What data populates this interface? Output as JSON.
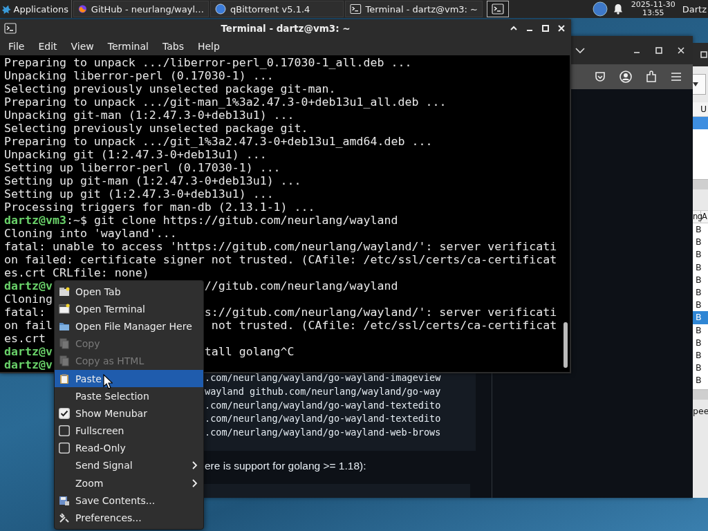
{
  "taskbar": {
    "apps_menu": "Applications",
    "tasks": [
      {
        "title": "GitHub - neurlang/wayl…",
        "kind": "browser"
      },
      {
        "title": "qBittorrent v5.1.4",
        "kind": "torrent"
      },
      {
        "title": "Terminal - dartz@vm3: ~",
        "kind": "terminal"
      }
    ],
    "clock": {
      "date": "2025-11-30",
      "time": "13:55"
    },
    "user": "Dartz"
  },
  "browser": {
    "code_lines": [
      ".com/neurlang/wayland/go-wayland-imageview",
      "wayland github.com/neurlang/wayland/go-way",
      ".com/neurlang/wayland/go-wayland-textedito",
      ".com/neurlang/wayland/go-wayland-textedito",
      ".com/neurlang/wayland/go-wayland-web-brows"
    ],
    "paragraph": "ere is support for golang >= 1.18):"
  },
  "qbittorrent": {
    "list": {
      "header": "U",
      "rows": [
        {
          "selected": true
        }
      ]
    },
    "peers": {
      "headers": [
        "ng",
        "A"
      ],
      "rows": [
        {
          "text": "B",
          "selected": false
        },
        {
          "text": "B",
          "selected": false
        },
        {
          "text": "B",
          "selected": false
        },
        {
          "text": "B",
          "selected": false
        },
        {
          "text": "B",
          "selected": false
        },
        {
          "text": "B",
          "selected": false
        },
        {
          "text": "B",
          "selected": false
        },
        {
          "text": "B",
          "selected": true
        },
        {
          "text": "B",
          "selected": false
        },
        {
          "text": "B",
          "selected": false
        },
        {
          "text": "B",
          "selected": false
        },
        {
          "text": "B",
          "selected": false
        },
        {
          "text": "B",
          "selected": false
        }
      ]
    },
    "status": "pee"
  },
  "terminal": {
    "title": "Terminal - dartz@vm3: ~",
    "menu": [
      "File",
      "Edit",
      "View",
      "Terminal",
      "Tabs",
      "Help"
    ],
    "lines": [
      {
        "kind": "output",
        "text": "Preparing to unpack .../liberror-perl_0.17030-1_all.deb ..."
      },
      {
        "kind": "output",
        "text": "Unpacking liberror-perl (0.17030-1) ..."
      },
      {
        "kind": "output",
        "text": "Selecting previously unselected package git-man."
      },
      {
        "kind": "output",
        "text": "Preparing to unpack .../git-man_1%3a2.47.3-0+deb13u1_all.deb ..."
      },
      {
        "kind": "output",
        "text": "Unpacking git-man (1:2.47.3-0+deb13u1) ..."
      },
      {
        "kind": "output",
        "text": "Selecting previously unselected package git."
      },
      {
        "kind": "output",
        "text": "Preparing to unpack .../git_1%3a2.47.3-0+deb13u1_amd64.deb ..."
      },
      {
        "kind": "output",
        "text": "Unpacking git (1:2.47.3-0+deb13u1) ..."
      },
      {
        "kind": "output",
        "text": "Setting up liberror-perl (0.17030-1) ..."
      },
      {
        "kind": "output",
        "text": "Setting up git-man (1:2.47.3-0+deb13u1) ..."
      },
      {
        "kind": "output",
        "text": "Setting up git (1:2.47.3-0+deb13u1) ..."
      },
      {
        "kind": "output",
        "text": "Processing triggers for man-db (2.13.1-1) ..."
      },
      {
        "kind": "prompt",
        "user": "dartz@vm3",
        "path": ":~$",
        "command": "git clone https://gitub.com/neurlang/wayland"
      },
      {
        "kind": "output",
        "text": "Cloning into 'wayland'..."
      },
      {
        "kind": "output",
        "text": "fatal: unable to access 'https://gitub.com/neurlang/wayland/': server verificati"
      },
      {
        "kind": "output",
        "text": "on failed: certificate signer not trusted. (CAfile: /etc/ssl/certs/ca-certificat"
      },
      {
        "kind": "output",
        "text": "es.crt CRLfile: none)"
      },
      {
        "kind": "covered_prompt",
        "left": "dartz@v",
        "right": "//gitub.com/neurlang/wayland"
      },
      {
        "kind": "covered",
        "left": "Cloning"
      },
      {
        "kind": "covered",
        "left": "fatal:",
        "right": "s://gitub.com/neurlang/wayland/': server verificati"
      },
      {
        "kind": "covered",
        "left": "on fail",
        "right": " not trusted. (CAfile: /etc/ssl/certs/ca-certificat"
      },
      {
        "kind": "covered",
        "left": "es.crt"
      },
      {
        "kind": "covered_prompt",
        "left": "dartz@v",
        "right": "tall golang^C"
      },
      {
        "kind": "covered_prompt",
        "left": "dartz@v"
      }
    ]
  },
  "context_menu": {
    "items": [
      {
        "label": "Open Tab",
        "kind": "icon",
        "disabled": false,
        "selected": false
      },
      {
        "label": "Open Terminal",
        "kind": "icon",
        "disabled": false,
        "selected": false
      },
      {
        "label": "Open File Manager Here",
        "kind": "icon",
        "disabled": false,
        "selected": false
      },
      {
        "label": "Copy",
        "kind": "icon",
        "disabled": true,
        "selected": false
      },
      {
        "label": "Copy as HTML",
        "kind": "icon",
        "disabled": true,
        "selected": false
      },
      {
        "label": "Paste",
        "kind": "icon",
        "disabled": false,
        "selected": true
      },
      {
        "label": "Paste Selection",
        "kind": "plain",
        "disabled": false,
        "selected": false
      },
      {
        "label": "Show Menubar",
        "kind": "check",
        "checked": true,
        "disabled": false,
        "selected": false
      },
      {
        "label": "Fullscreen",
        "kind": "check",
        "checked": false,
        "disabled": false,
        "selected": false
      },
      {
        "label": "Read-Only",
        "kind": "check",
        "checked": false,
        "disabled": false,
        "selected": false
      },
      {
        "label": "Send Signal",
        "kind": "submenu",
        "disabled": false,
        "selected": false
      },
      {
        "label": "Zoom",
        "kind": "submenu",
        "disabled": false,
        "selected": false
      },
      {
        "label": "Save Contents...",
        "kind": "icon",
        "disabled": false,
        "selected": false
      },
      {
        "label": "Preferences...",
        "kind": "icon",
        "disabled": false,
        "selected": false
      }
    ]
  }
}
